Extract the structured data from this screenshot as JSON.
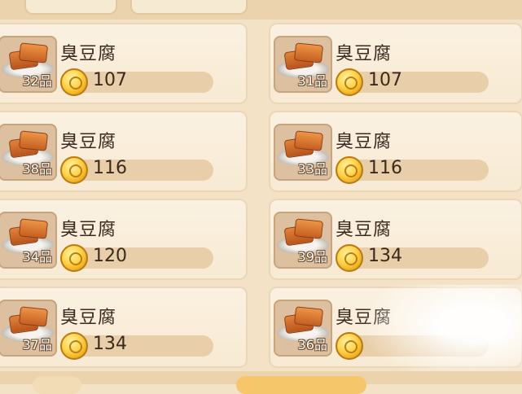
{
  "shop": {
    "items": [
      {
        "name": "臭豆腐",
        "grade": "32品",
        "price": "107"
      },
      {
        "name": "臭豆腐",
        "grade": "31品",
        "price": "107"
      },
      {
        "name": "臭豆腐",
        "grade": "38品",
        "price": "116"
      },
      {
        "name": "臭豆腐",
        "grade": "33品",
        "price": "116"
      },
      {
        "name": "臭豆腐",
        "grade": "34品",
        "price": "120"
      },
      {
        "name": "臭豆腐",
        "grade": "39品",
        "price": "134"
      },
      {
        "name": "臭豆腐",
        "grade": "37品",
        "price": "134"
      },
      {
        "name": "臭豆腐",
        "grade": "36品",
        "price": ""
      }
    ],
    "icons": {
      "item": "stinky-tofu-icon",
      "currency": "gold-coin-icon"
    }
  }
}
